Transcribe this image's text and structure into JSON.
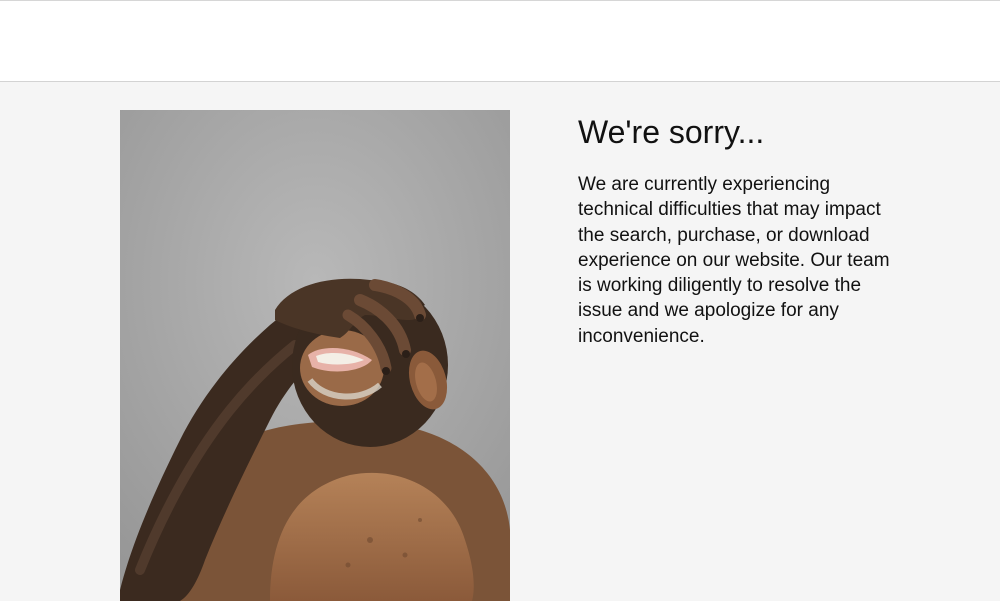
{
  "header": {},
  "error": {
    "title": "We're sorry...",
    "message": "We are currently experiencing technical difficulties that may impact the search, purchase, or download experience on our website. Our team is working diligently to resolve the issue and we apologize for any inconvenience."
  },
  "illustration": {
    "subject": "chimpanzee-covering-eyes",
    "background_color": "#a9a9a9",
    "fur_color": "#3a2a1f",
    "skin_color": "#a07250"
  }
}
